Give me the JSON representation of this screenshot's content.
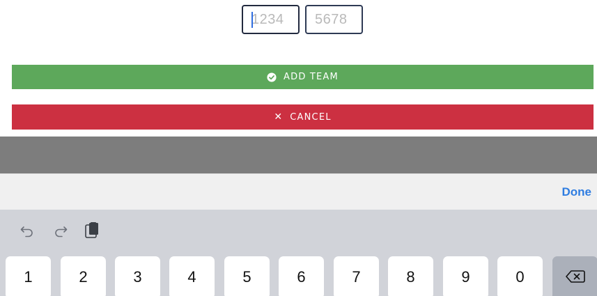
{
  "pin": {
    "field1_placeholder": "1234",
    "field2_placeholder": "5678"
  },
  "buttons": {
    "add_team_label": "ADD TEAM",
    "cancel_label": "CANCEL",
    "add_team_color": "#5da85b",
    "cancel_color": "#cc3041"
  },
  "accessory_bar": {
    "done_label": "Done",
    "done_color": "#2f7de1"
  },
  "keyboard": {
    "toolbar_icons": [
      "undo-icon",
      "redo-icon",
      "paste-icon"
    ],
    "keys": [
      "1",
      "2",
      "3",
      "4",
      "5",
      "6",
      "7",
      "8",
      "9",
      "0"
    ],
    "delete_icon": "backspace-icon"
  }
}
